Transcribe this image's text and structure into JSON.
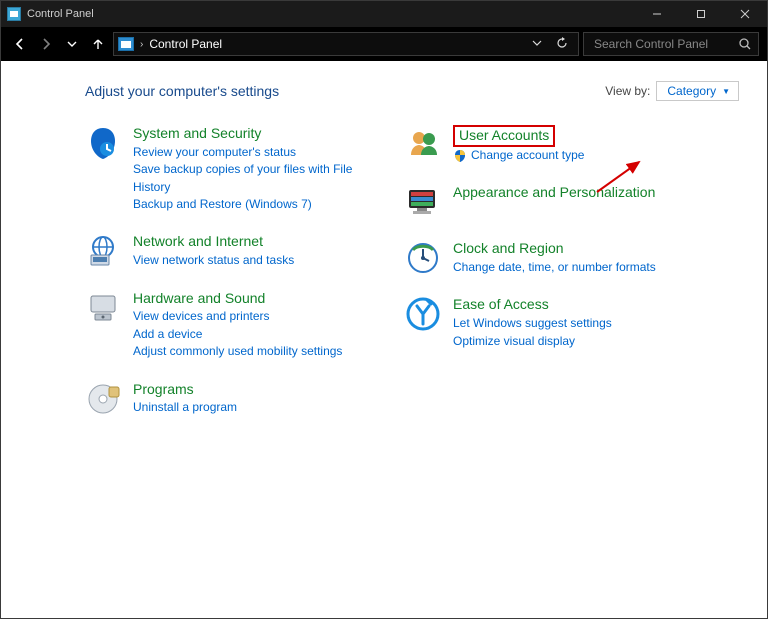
{
  "titlebar": {
    "title": "Control Panel"
  },
  "nav": {
    "breadcrumb": "Control Panel",
    "searchPlaceholder": "Search Control Panel"
  },
  "header": {
    "title": "Adjust your computer's settings",
    "viewby_label": "View by:",
    "viewby_value": "Category"
  },
  "leftCats": [
    {
      "name": "system-security",
      "title": "System and Security",
      "links": [
        "Review your computer's status",
        "Save backup copies of your files with File History",
        "Backup and Restore (Windows 7)"
      ]
    },
    {
      "name": "network-internet",
      "title": "Network and Internet",
      "links": [
        "View network status and tasks"
      ]
    },
    {
      "name": "hardware-sound",
      "title": "Hardware and Sound",
      "links": [
        "View devices and printers",
        "Add a device",
        "Adjust commonly used mobility settings"
      ]
    },
    {
      "name": "programs",
      "title": "Programs",
      "links": [
        "Uninstall a program"
      ]
    }
  ],
  "rightCats": [
    {
      "name": "user-accounts",
      "title": "User Accounts",
      "highlight": true,
      "links": [
        "Change account type"
      ],
      "linkShield": [
        true
      ]
    },
    {
      "name": "appearance-personalization",
      "title": "Appearance and Personalization",
      "links": []
    },
    {
      "name": "clock-region",
      "title": "Clock and Region",
      "links": [
        "Change date, time, or number formats"
      ]
    },
    {
      "name": "ease-of-access",
      "title": "Ease of Access",
      "links": [
        "Let Windows suggest settings",
        "Optimize visual display"
      ]
    }
  ]
}
